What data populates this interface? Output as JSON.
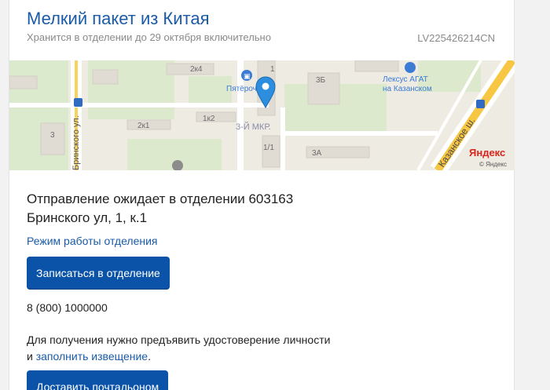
{
  "parcel": {
    "title": "Мелкий пакет из Китая",
    "storage_note": "Хранится в отделении до 29 октября включительно",
    "tracking_number": "LV225426214CN"
  },
  "map": {
    "labels": {
      "district": "3-Й МКР.",
      "shop": "Пятёрочка",
      "dealer_line1": "Лексус АГАТ",
      "dealer_line2": "на Казанском",
      "highway": "Казанское ш.",
      "street": "Бринского ул.",
      "brand": "Яндекс",
      "copyright": "© Яндекс",
      "bld_2k4": "2к4",
      "bld_2k1": "2к1",
      "bld_1k2": "1к2",
      "bld_3b": "3Б",
      "bld_3a": "3А",
      "bld_1": "1",
      "bld_1_1": "1/1",
      "bld_3": "3"
    }
  },
  "office": {
    "status_line1": "Отправление ожидает в отделении 603163",
    "status_line2": "Бринского ул, 1, к.1",
    "hours_link": "Режим работы отделения",
    "appointment_button": "Записаться в отделение",
    "phone": "8 (800) 1000000",
    "notice_text": "Для получения нужно предъявить удостоверение личности",
    "notice_prefix": "и ",
    "notice_link": "заполнить извещение",
    "notice_suffix": ".",
    "delivery_button": "Доставить почтальоном"
  },
  "colors": {
    "accent": "#1a5ba8",
    "button": "#0a53a8",
    "muted_text": "#8a8a8a"
  }
}
